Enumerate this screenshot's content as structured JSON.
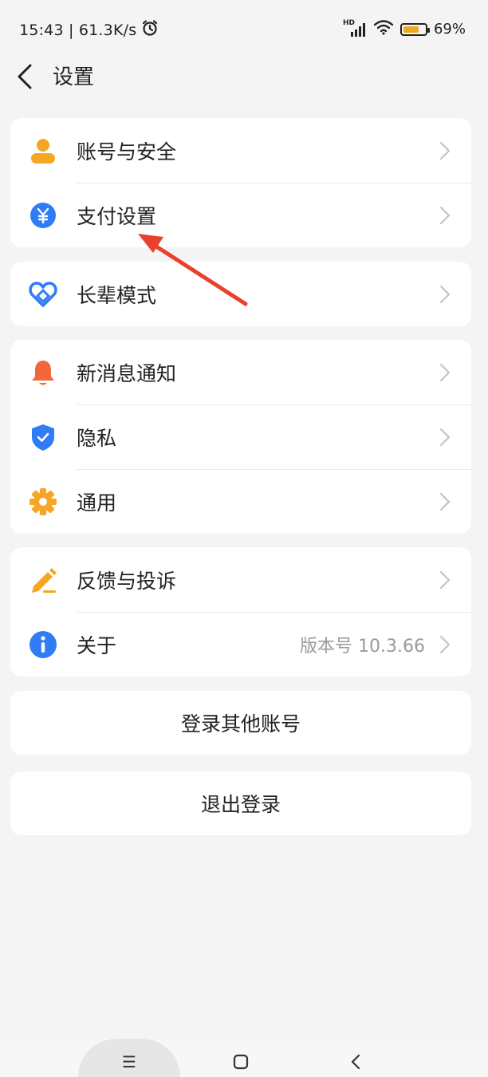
{
  "status_bar": {
    "time_speed": "15:43 | 61.3K/s",
    "network_label": "HD",
    "battery_percent": "69%",
    "battery_level": 0.69,
    "icons": [
      "alarm-icon",
      "signal-icon",
      "wifi-icon",
      "battery-icon"
    ]
  },
  "header": {
    "title": "设置",
    "back_icon": "chevron-left-icon"
  },
  "groups": [
    {
      "items": [
        {
          "label": "账号与安全",
          "icon": "person-icon",
          "color": "#F5A623"
        },
        {
          "label": "支付设置",
          "icon": "yuan-icon",
          "color": "#2F7CF6"
        }
      ]
    },
    {
      "items": [
        {
          "label": "长辈模式",
          "icon": "heart-icon",
          "color": "#2F7CF6"
        }
      ]
    },
    {
      "items": [
        {
          "label": "新消息通知",
          "icon": "bell-icon",
          "color": "#F2683C"
        },
        {
          "label": "隐私",
          "icon": "shield-icon",
          "color": "#2F7CF6"
        },
        {
          "label": "通用",
          "icon": "gear-icon",
          "color": "#F5A623"
        }
      ]
    },
    {
      "items": [
        {
          "label": "反馈与投诉",
          "icon": "pencil-icon",
          "color": "#F5A623"
        },
        {
          "label": "关于",
          "icon": "info-icon",
          "color": "#2F7CF6",
          "value": "版本号 10.3.66"
        }
      ]
    }
  ],
  "actions": {
    "switch_account": "登录其他账号",
    "logout": "退出登录"
  },
  "system_nav": {
    "menu_label": "☰"
  },
  "annotation": {
    "arrow_color": "#E8422E"
  }
}
